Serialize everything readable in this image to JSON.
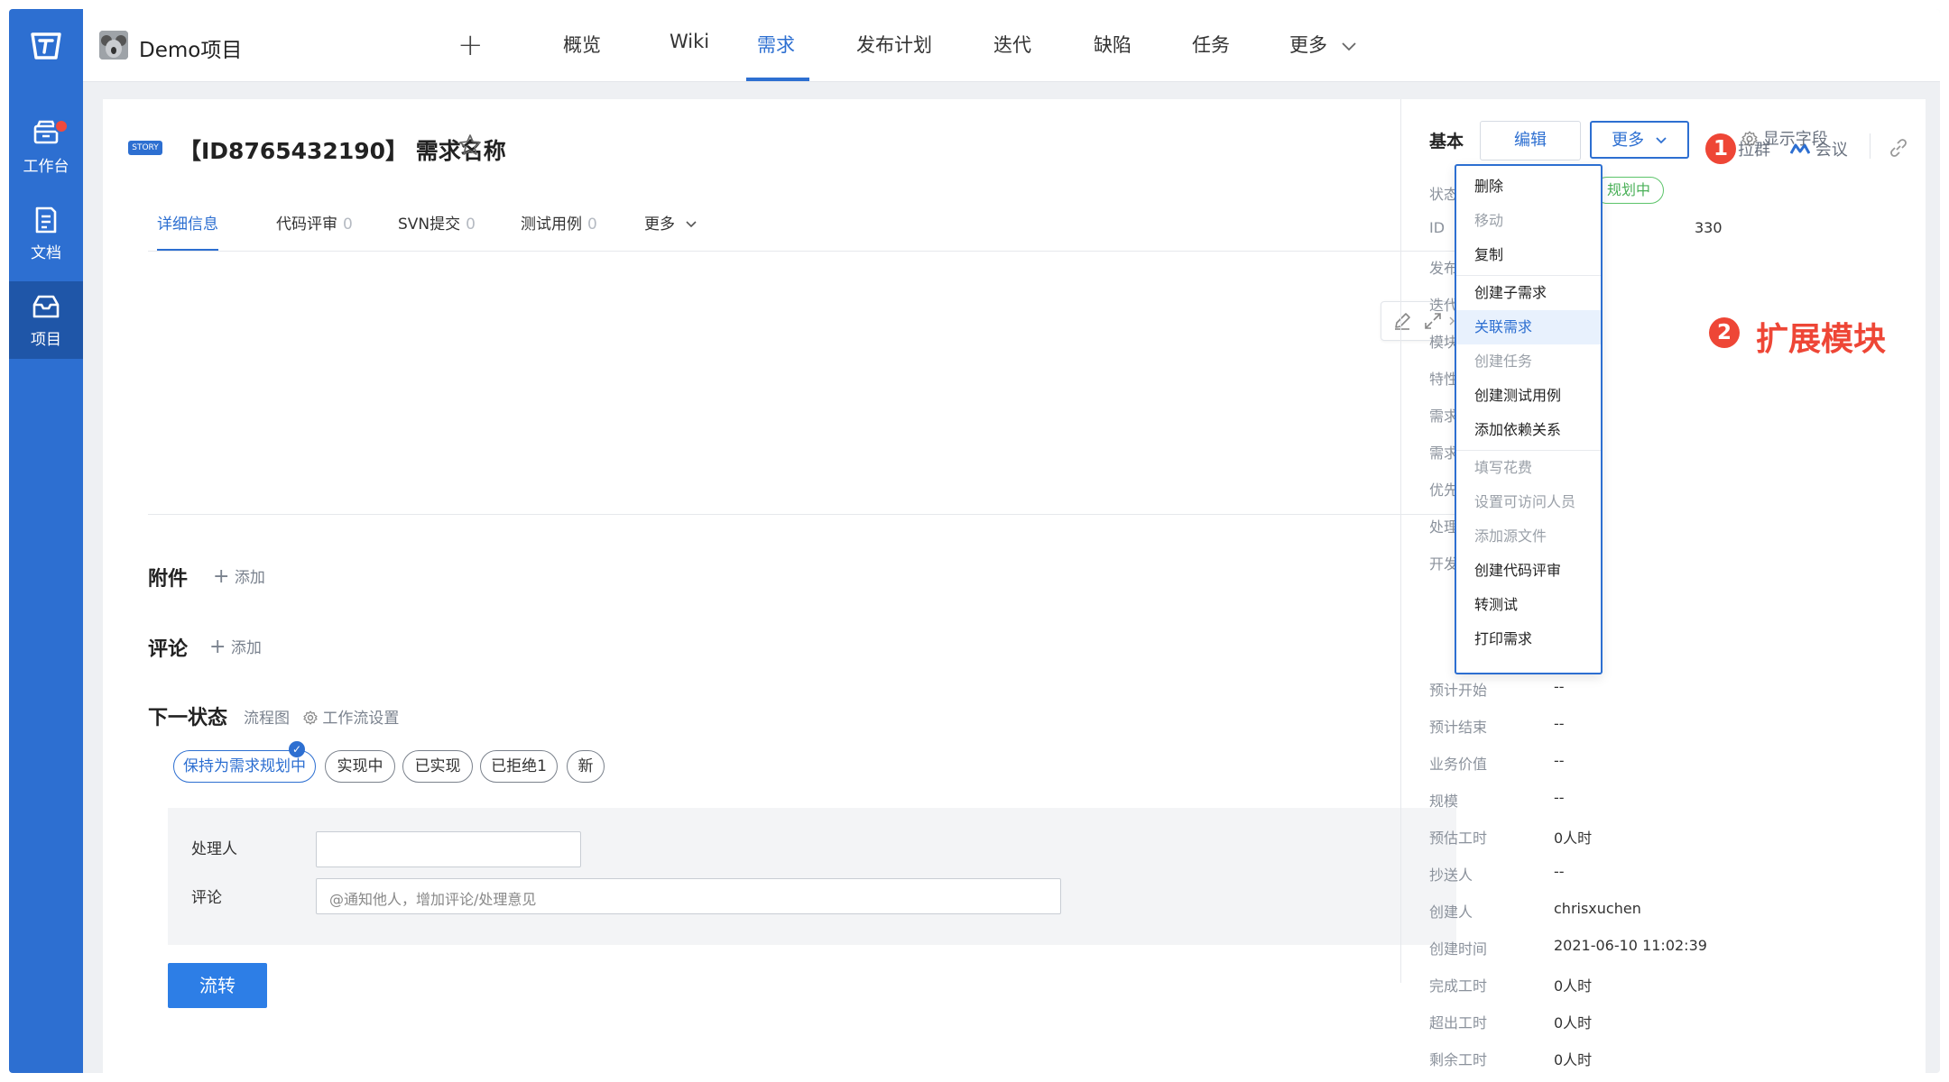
{
  "sidebar": {
    "items": [
      {
        "label": "工作台",
        "icon": "workbench-icon"
      },
      {
        "label": "文档",
        "icon": "document-icon"
      },
      {
        "label": "项目",
        "icon": "project-icon"
      }
    ]
  },
  "topnav": {
    "project_name": "Demo项目",
    "add_symbol": "+",
    "tabs": [
      "概览",
      "Wiki",
      "需求",
      "发布计划",
      "迭代",
      "缺陷",
      "任务",
      "更多"
    ],
    "active_tab": "需求"
  },
  "story": {
    "badge": "STORY",
    "title": "【ID8765432190】 需求名称",
    "edit_label": "编辑",
    "more_label": "更多",
    "pull_group": "拉群",
    "meeting": "会议"
  },
  "subtabs": [
    {
      "label": "详细信息",
      "count": ""
    },
    {
      "label": "代码评审",
      "count": "0"
    },
    {
      "label": "SVN提交",
      "count": "0"
    },
    {
      "label": "测试用例",
      "count": "0"
    },
    {
      "label": "更多",
      "count": ""
    }
  ],
  "sections": {
    "attachments": "附件",
    "comments": "评论",
    "add": "添加",
    "next_state": "下一状态",
    "flowchart": "流程图",
    "workflow_settings": "工作流设置"
  },
  "states": [
    "保持为需求规划中",
    "实现中",
    "已实现",
    "已拒绝1",
    "新"
  ],
  "form": {
    "assignee_label": "处理人",
    "comment_label": "评论",
    "comment_placeholder": "@通知他人，增加评论/处理意见",
    "submit": "流转"
  },
  "right_panel": {
    "title": "基本",
    "show_fields": "显示字段",
    "state_badge": "规划中",
    "id_fragment": "330",
    "labels_partial": [
      "状态",
      "ID",
      "发布",
      "迭代",
      "模块",
      "特性",
      "需求",
      "需求",
      "优先",
      "处理",
      "开发"
    ],
    "fields": [
      {
        "label": "预计开始",
        "value": "--"
      },
      {
        "label": "预计结束",
        "value": "--"
      },
      {
        "label": "业务价值",
        "value": "--"
      },
      {
        "label": "规模",
        "value": "--"
      },
      {
        "label": "预估工时",
        "value": "0人时"
      },
      {
        "label": "抄送人",
        "value": "--"
      },
      {
        "label": "创建人",
        "value": "chrisxuchen"
      },
      {
        "label": "创建时间",
        "value": "2021-06-10 11:02:39"
      },
      {
        "label": "完成工时",
        "value": "0人时"
      },
      {
        "label": "超出工时",
        "value": "0人时"
      },
      {
        "label": "剩余工时",
        "value": "0人时"
      }
    ]
  },
  "dropdown": {
    "items": [
      {
        "label": "删除",
        "enabled": true
      },
      {
        "label": "移动",
        "enabled": false
      },
      {
        "label": "复制",
        "enabled": true
      },
      {
        "label": "创建子需求",
        "enabled": true
      },
      {
        "label": "关联需求",
        "enabled": true,
        "hover": true
      },
      {
        "label": "创建任务",
        "enabled": false
      },
      {
        "label": "创建测试用例",
        "enabled": true
      },
      {
        "label": "添加依赖关系",
        "enabled": true
      },
      {
        "label": "填写花费",
        "enabled": false
      },
      {
        "label": "设置可访问人员",
        "enabled": false
      },
      {
        "label": "添加源文件",
        "enabled": false
      },
      {
        "label": "创建代码评审",
        "enabled": true
      },
      {
        "label": "转测试",
        "enabled": true
      },
      {
        "label": "打印需求",
        "enabled": true
      }
    ]
  },
  "annotations": {
    "marker1": "1",
    "marker2": "2",
    "callout": "扩展模块"
  },
  "colors": {
    "brand": "#2d6fd1",
    "annotation": "#ee4636",
    "state_green": "#4ab058"
  }
}
